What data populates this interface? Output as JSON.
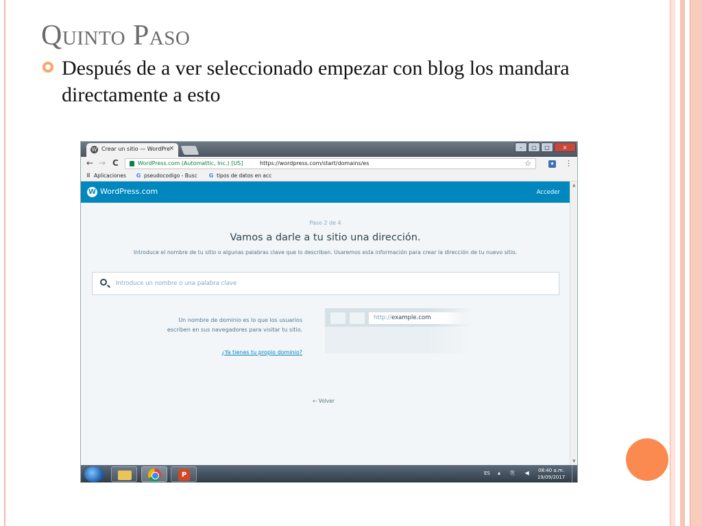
{
  "slide": {
    "title": "Quinto Paso",
    "bullet": "Después de a ver seleccionado empezar con blog los mandara directamente a esto"
  },
  "browser": {
    "tab_title": "Crear un sitio — WordPre",
    "tab_close": "×",
    "window_controls": {
      "minimize": "–",
      "restore": "▢",
      "maximize": "□",
      "close": "×"
    },
    "nav": {
      "back": "←",
      "forward": "→",
      "reload": "C"
    },
    "secure_label": "WordPress.com (Automattic, Inc.) [US]",
    "url": "https://wordpress.com/start/domains/es",
    "bookmarks": [
      {
        "icon": "apps-icon",
        "label": "Aplicaciones"
      },
      {
        "icon": "google-icon",
        "label": "pseudocodigo - Busc"
      },
      {
        "icon": "google-icon",
        "label": "tipos de datos en acc"
      }
    ]
  },
  "wordpress": {
    "brand": "WordPress.com",
    "login": "Acceder",
    "step": "Paso 2 de 4",
    "heading": "Vamos a darle a tu sitio una dirección.",
    "subheading": "Introduce el nombre de tu sitio o algunas palabras clave que lo describan. Usaremos esta información para crear la dirección de tu nuevo sitio.",
    "search_placeholder": "Introduce un nombre o una palabra clave",
    "info_text": "Un nombre de dominio es lo que los usuarios escriben en sus navegadores para visitar tu sitio.",
    "info_link": "¿Ya tienes tu propio dominio?",
    "mock_url_prefix": "http://",
    "mock_url_domain": "example.com",
    "back_label": "← Volver"
  },
  "taskbar": {
    "language": "ES",
    "time": "08:40 a.m.",
    "date": "19/09/2017"
  },
  "colors": {
    "wp_blue": "#0087be",
    "accent_orange": "#fa8a4f",
    "slide_title": "#6b6b6b"
  }
}
